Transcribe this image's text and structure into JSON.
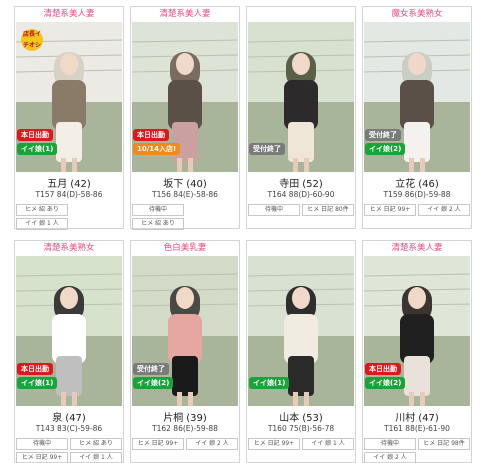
{
  "cards": [
    {
      "category": "清楚系美人妻",
      "name": "五月",
      "age": "(42)",
      "spec": "T157 84(D)-58-86",
      "badges": [
        "本日出勤",
        "イイ娘(1)"
      ],
      "shop_badge": "店長イチオシ",
      "tags": [
        [
          "ヒメ 紹 あり",
          ""
        ],
        [
          "イイ 娘 1 人",
          ""
        ]
      ]
    },
    {
      "category": "清楚系美人妻",
      "name": "坂下",
      "age": "(40)",
      "spec": "T156 84(E)-58-86",
      "badges": [
        "本日出勤",
        "10/14入店!"
      ],
      "tags": [
        [
          "待機中",
          ""
        ],
        [
          "ヒメ 紹 あり",
          ""
        ]
      ]
    },
    {
      "category": "",
      "name": "寺田",
      "age": "(52)",
      "spec": "T164 88(D)-60-90",
      "badges": [
        "受付終了"
      ],
      "tags": [
        [
          "待機中",
          "ヒメ 日記 80件"
        ]
      ]
    },
    {
      "category": "魔女系美熟女",
      "name": "立花",
      "age": "(46)",
      "spec": "T159 86(D)-59-88",
      "badges": [
        "受付終了",
        "イイ娘(2)"
      ],
      "tags": [
        [
          "ヒメ 日記 99+",
          "イイ 娘 2 人"
        ]
      ]
    },
    {
      "category": "清楚系美熟女",
      "name": "泉",
      "age": "(47)",
      "spec": "T143 83(C)-59-86",
      "badges": [
        "本日出勤",
        "イイ娘(1)"
      ],
      "tags": [
        [
          "待機中",
          "ヒメ 紹 あり"
        ],
        [
          "ヒメ 日記 99+",
          "イイ 娘 1 人"
        ]
      ]
    },
    {
      "category": "色白美乳妻",
      "name": "片桐",
      "age": "(39)",
      "spec": "T162 86(E)-59-88",
      "badges": [
        "受付終了",
        "イイ娘(2)"
      ],
      "tags": [
        [
          "ヒメ 日記 99+",
          "イイ 娘 2 人"
        ]
      ]
    },
    {
      "category": "",
      "name": "山本",
      "age": "(53)",
      "spec": "T160 75(B)-56-78",
      "badges": [
        "イイ娘(1)"
      ],
      "tags": [
        [
          "ヒメ 日記 99+",
          "イイ 娘 1 人"
        ]
      ]
    },
    {
      "category": "清楚系美人妻",
      "name": "川村",
      "age": "(47)",
      "spec": "T161 88(E)-61-90",
      "badges": [
        "本日出勤",
        "イイ娘(2)"
      ],
      "tags": [
        [
          "待機中",
          "ヒメ 日記 98件"
        ],
        [
          "イイ 娘 2 人",
          ""
        ]
      ]
    }
  ],
  "colors": {
    "pink": "#e8487a",
    "red": "#e0161d",
    "green": "#1aa33a",
    "gray": "#7a7a7a",
    "orange": "#f08a1a"
  }
}
